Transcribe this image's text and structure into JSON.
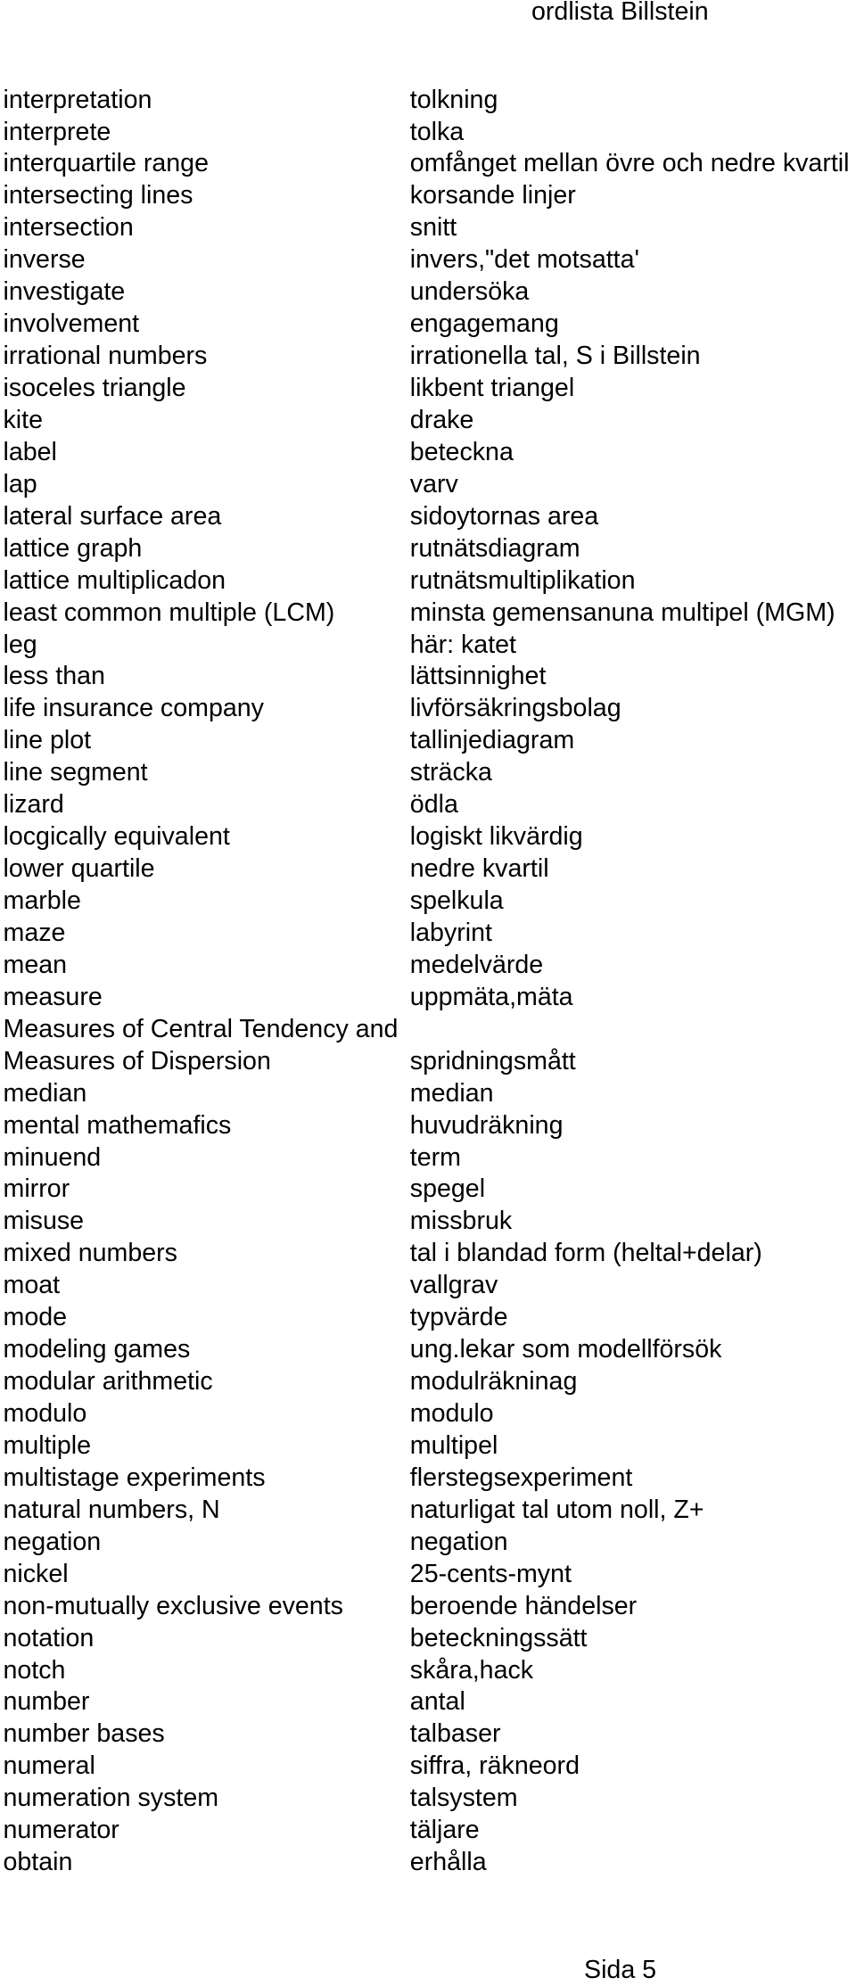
{
  "header": {
    "title": "ordlista Billstein"
  },
  "glossary": [
    {
      "term": "interpretation",
      "translation": "tolkning"
    },
    {
      "term": "interprete",
      "translation": "tolka"
    },
    {
      "term": "interquartile range",
      "translation": "omfånget mellan övre och nedre kvartil"
    },
    {
      "term": "intersecting lines",
      "translation": "korsande linjer"
    },
    {
      "term": "intersection",
      "translation": "snitt"
    },
    {
      "term": "inverse",
      "translation": "invers,\"det motsatta'"
    },
    {
      "term": "investigate",
      "translation": "undersöka"
    },
    {
      "term": "involvement",
      "translation": "engagemang"
    },
    {
      "term": "irrational numbers",
      "translation": "irrationella tal, S i Billstein"
    },
    {
      "term": "isoceles triangle",
      "translation": "likbent triangel"
    },
    {
      "term": "kite",
      "translation": "drake"
    },
    {
      "term": "label",
      "translation": "beteckna"
    },
    {
      "term": "lap",
      "translation": "varv"
    },
    {
      "term": "lateral surface area",
      "translation": "sidoytornas area"
    },
    {
      "term": "lattice graph",
      "translation": "rutnätsdiagram"
    },
    {
      "term": "lattice multiplicadon",
      "translation": "rutnätsmultiplikation"
    },
    {
      "term": "least common multiple (LCM)",
      "translation": "minsta gemensanuna multipel (MGM)"
    },
    {
      "term": "leg",
      "translation": "här: katet"
    },
    {
      "term": "less than",
      "translation": "lättsinnighet"
    },
    {
      "term": "life insurance company",
      "translation": "livförsäkringsbolag"
    },
    {
      "term": "line plot",
      "translation": "tallinjediagram"
    },
    {
      "term": "line segment",
      "translation": "sträcka"
    },
    {
      "term": "lizard",
      "translation": "ödla"
    },
    {
      "term": "locgically equivalent",
      "translation": "logiskt likvärdig"
    },
    {
      "term": "lower quartile",
      "translation": "nedre kvartil"
    },
    {
      "term": "marble",
      "translation": "spelkula"
    },
    {
      "term": "maze",
      "translation": "labyrint"
    },
    {
      "term": "mean",
      "translation": "medelvärde"
    },
    {
      "term": "measure",
      "translation": "uppmäta,mäta"
    },
    {
      "term": "Measures of Central Tendency and",
      "translation": ""
    },
    {
      "term": "Measures of Dispersion",
      "translation": "spridningsmått"
    },
    {
      "term": "median",
      "translation": "median"
    },
    {
      "term": "mental mathemafics",
      "translation": "huvudräkning"
    },
    {
      "term": "minuend",
      "translation": "term"
    },
    {
      "term": "mirror",
      "translation": "spegel"
    },
    {
      "term": "misuse",
      "translation": "missbruk"
    },
    {
      "term": "mixed numbers",
      "translation": "tal i blandad form (heltal+delar)"
    },
    {
      "term": "moat",
      "translation": "vallgrav"
    },
    {
      "term": "mode",
      "translation": "typvärde"
    },
    {
      "term": "modeling games",
      "translation": "ung.lekar som modellförsök"
    },
    {
      "term": "modular arithmetic",
      "translation": "modulräkninag"
    },
    {
      "term": "modulo",
      "translation": "modulo"
    },
    {
      "term": "multiple",
      "translation": "multipel"
    },
    {
      "term": "multistage experiments",
      "translation": "flerstegsexperiment"
    },
    {
      "term": "natural numbers, N",
      "translation": "naturligat tal utom noll, Z+"
    },
    {
      "term": "negation",
      "translation": "negation"
    },
    {
      "term": "nickel",
      "translation": "25-cents-mynt"
    },
    {
      "term": "non-mutually exclusive events",
      "translation": "beroende händelser"
    },
    {
      "term": "notation",
      "translation": "beteckningssätt"
    },
    {
      "term": "notch",
      "translation": "skåra,hack"
    },
    {
      "term": "number",
      "translation": "antal"
    },
    {
      "term": "number bases",
      "translation": "talbaser"
    },
    {
      "term": "numeral",
      "translation": "siffra, räkneord"
    },
    {
      "term": "numeration system",
      "translation": "talsystem"
    },
    {
      "term": "numerator",
      "translation": "täljare"
    },
    {
      "term": "obtain",
      "translation": "erhålla"
    }
  ],
  "footer": {
    "page_label": "Sida 5"
  }
}
